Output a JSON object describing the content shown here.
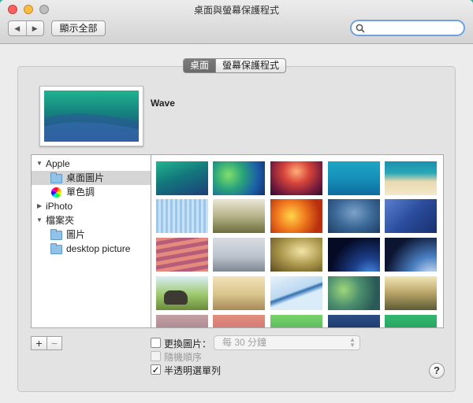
{
  "window": {
    "title": "桌面與螢幕保護程式"
  },
  "toolbar": {
    "back_glyph": "◀",
    "forward_glyph": "▶",
    "show_all_label": "顯示全部",
    "search_placeholder": ""
  },
  "tabs": [
    {
      "label": "桌面",
      "active": true
    },
    {
      "label": "螢幕保護程式",
      "active": false
    }
  ],
  "current_picture": {
    "name": "Wave"
  },
  "sidebar": {
    "items": [
      {
        "label": "Apple",
        "type": "group",
        "expanded": true
      },
      {
        "label": "桌面圖片",
        "type": "folder",
        "selected": true
      },
      {
        "label": "單色調",
        "type": "colors"
      },
      {
        "label": "iPhoto",
        "type": "group",
        "expanded": false
      },
      {
        "label": "檔案夾",
        "type": "group",
        "expanded": true
      },
      {
        "label": "圖片",
        "type": "folder"
      },
      {
        "label": "desktop picture",
        "type": "folder"
      }
    ]
  },
  "sidebar_controls": {
    "add": "+",
    "remove": "−"
  },
  "options": {
    "change_picture_label": "更換圖片：",
    "change_picture_checked": false,
    "interval_value": "每 30 分鐘",
    "random_order_label": "隨機順序",
    "random_order_checked": false,
    "translucent_menu_label": "半透明選單列",
    "translucent_menu_checked": true
  },
  "help_label": "?",
  "colors": {
    "accent": "#6ea1df",
    "desktop": "#2aa891"
  }
}
